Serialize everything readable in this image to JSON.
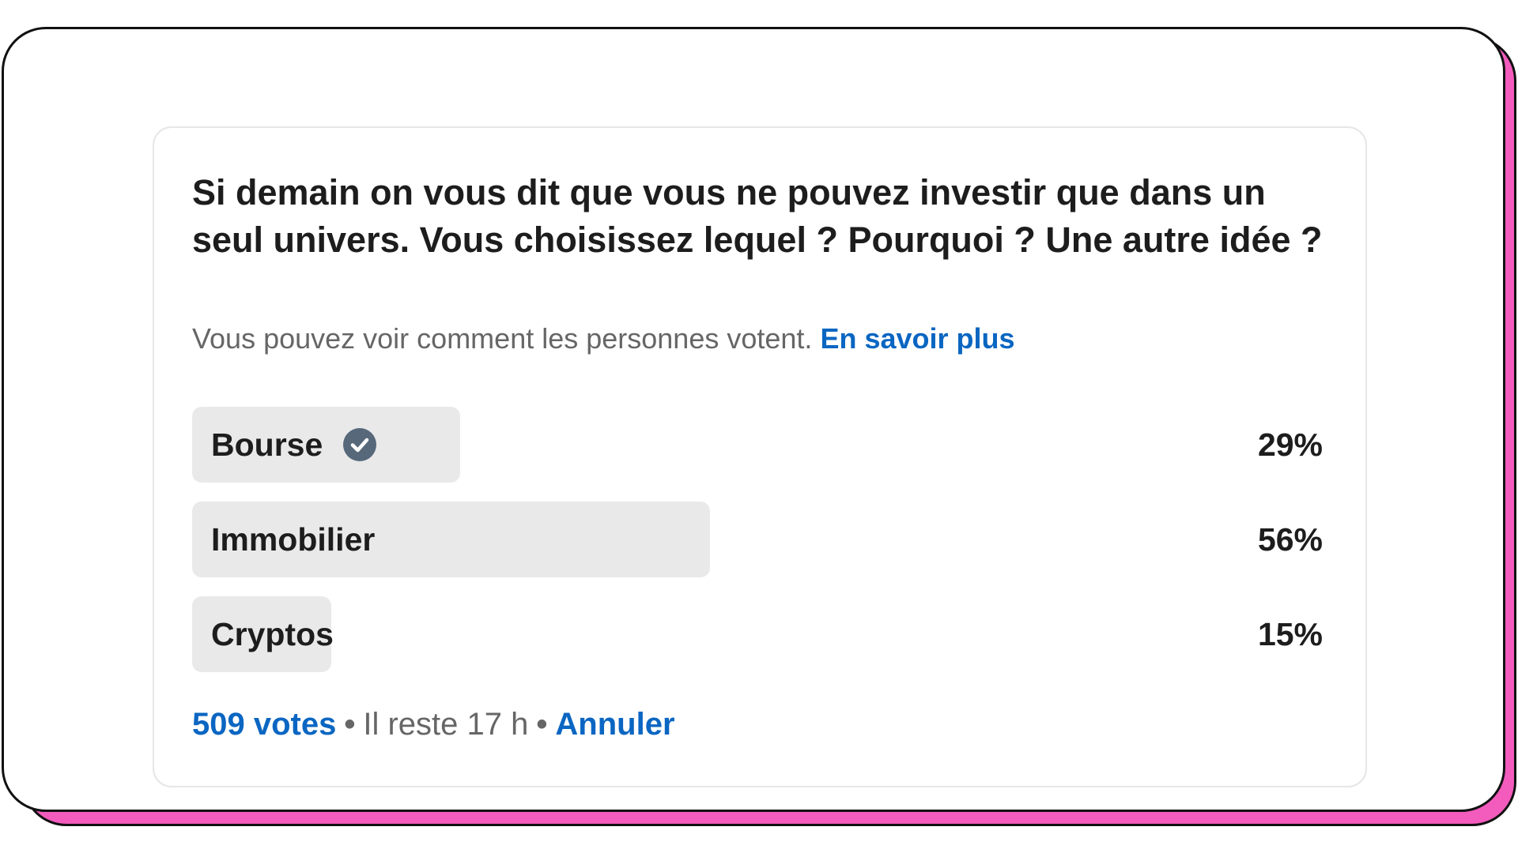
{
  "poll": {
    "question": "Si demain on vous dit que vous ne pouvez investir que dans un seul univers. Vous choisissez lequel ? Pourquoi ? Une autre idée ?",
    "visibility_text": "Vous pouvez voir comment les personnes votent.",
    "learn_more_label": "En savoir plus",
    "options": [
      {
        "label": "Bourse",
        "percent_label": "29%",
        "share": 0.29,
        "selected": true,
        "icon": "check-circle-icon"
      },
      {
        "label": "Immobilier",
        "percent_label": "56%",
        "share": 0.56,
        "selected": false
      },
      {
        "label": "Cryptos",
        "percent_label": "15%",
        "share": 0.15,
        "selected": false
      }
    ],
    "votes_label": "509 votes",
    "separator": "•",
    "time_left": "Il reste 17 h",
    "cancel_label": "Annuler"
  },
  "colors": {
    "link": "#0a66c2",
    "bar": "#e9e9e9",
    "frame_shadow": "#f35bbd",
    "check_icon": "#56687a"
  }
}
